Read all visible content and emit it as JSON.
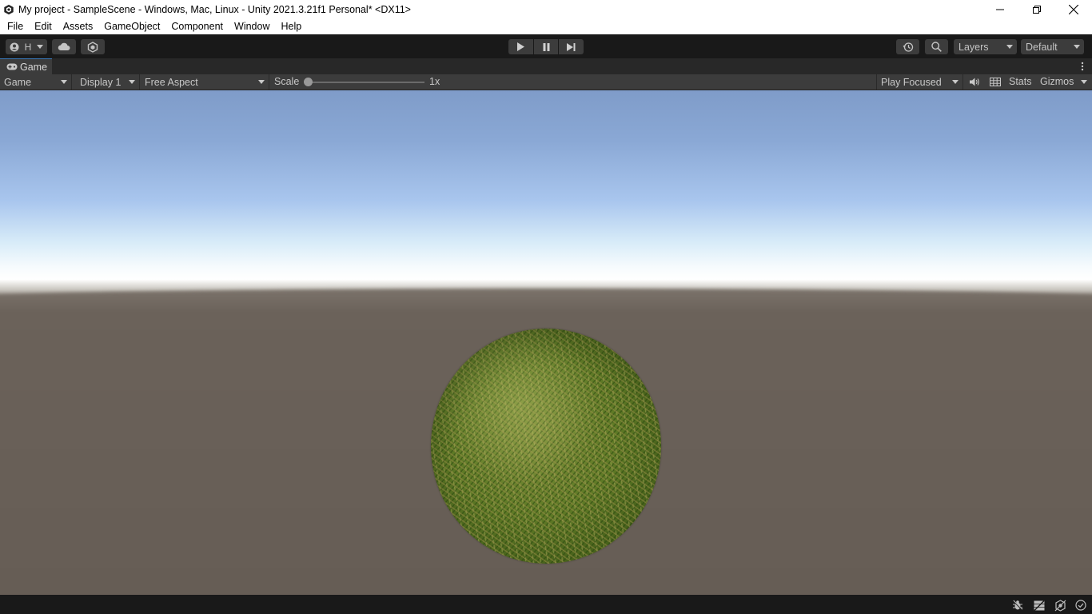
{
  "window": {
    "title": "My project - SampleScene - Windows, Mac, Linux - Unity 2021.3.21f1 Personal* <DX11>",
    "app_icon": "unity-logo-icon",
    "controls": [
      "minimize-icon",
      "restore-icon",
      "close-icon"
    ]
  },
  "menu": {
    "items": [
      "File",
      "Edit",
      "Assets",
      "GameObject",
      "Component",
      "Window",
      "Help"
    ]
  },
  "toolbar": {
    "account_letter": "H",
    "layers_label": "Layers",
    "layout_label": "Default",
    "icons": [
      "account-icon",
      "cloud-icon",
      "collab-icon",
      "play-icon",
      "pause-icon",
      "step-icon",
      "history-icon",
      "search-icon"
    ]
  },
  "tab": {
    "label": "Game",
    "icon": "gamepad-icon"
  },
  "game_toolbar": {
    "mode": "Game",
    "display": "Display 1",
    "aspect": "Free Aspect",
    "scale_label": "Scale",
    "scale_value": "1x",
    "scale_fraction": 0.0,
    "play_mode": "Play Focused",
    "stats_label": "Stats",
    "gizmos_label": "Gizmos"
  },
  "colors": {
    "accent": "#3a79bb",
    "panel": "#3c3c3c",
    "toolbar_bg": "#191919",
    "ground": "#665d55",
    "sky_top": "#7f9cc9"
  },
  "statusbar": {
    "icons": [
      "bug-icon",
      "cache-server-icon",
      "auto-generate-lighting-icon",
      "progress-check-icon"
    ]
  }
}
